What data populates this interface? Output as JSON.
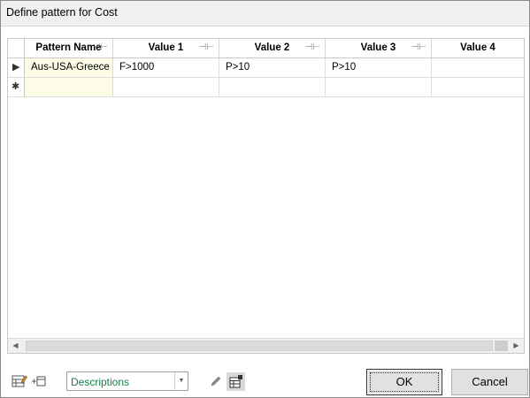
{
  "window": {
    "title": "Define pattern for Cost"
  },
  "grid": {
    "columns": [
      "Pattern Name",
      "Value 1",
      "Value 2",
      "Value 3",
      "Value 4"
    ],
    "rows": [
      {
        "indicator": "▶",
        "cells": [
          "Aus-USA-Greece",
          "F>1000",
          "P>10",
          "P>10",
          ""
        ]
      }
    ],
    "new_row_indicator": "✱"
  },
  "toolbar": {
    "description_mode": "Descriptions"
  },
  "buttons": {
    "ok": "OK",
    "cancel": "Cancel"
  }
}
